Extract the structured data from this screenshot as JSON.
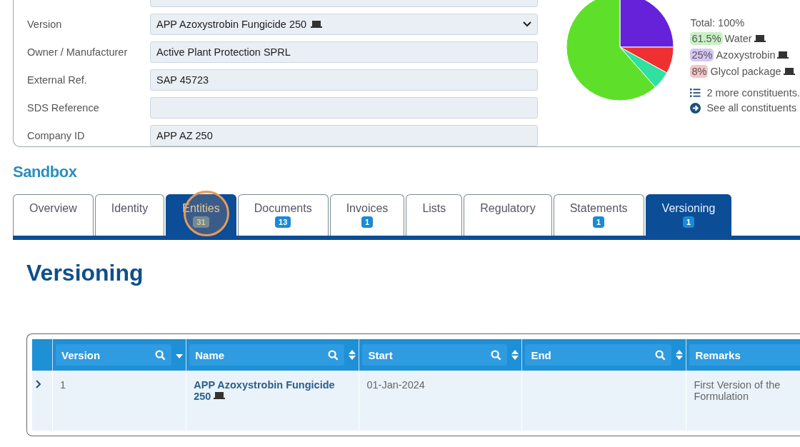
{
  "form": {
    "fields": [
      {
        "label": "Version",
        "value": "APP Azoxystrobin Fungicide 250",
        "kind": "select",
        "device": true
      },
      {
        "label": "Owner / Manufacturer",
        "value": "Active Plant Protection SPRL",
        "kind": "text",
        "device": false
      },
      {
        "label": "External Ref.",
        "value": "SAP 45723",
        "kind": "text",
        "device": false
      },
      {
        "label": "SDS Reference",
        "kind": "text",
        "device": false
      },
      {
        "label": "Company ID",
        "value": "APP AZ 250",
        "kind": "text",
        "device": false
      }
    ]
  },
  "composition": {
    "total": "Total: 100%",
    "constituents": [
      {
        "percent": "61.5%",
        "name": "Water",
        "color": "#c9f0c4"
      },
      {
        "percent": "25%",
        "name": "Azoxystrobin",
        "color": "#d6c6f5"
      },
      {
        "percent": "8%",
        "name": "Glycol package",
        "color": "#f5c6c6"
      }
    ],
    "more": "2 more constituents.",
    "see_all": "See all constituents"
  },
  "section_title": "Sandbox",
  "tabs": [
    {
      "label": "Overview",
      "selected": false,
      "hovered": false
    },
    {
      "label": "Identity",
      "selected": false,
      "hovered": false
    },
    {
      "label": "Entities",
      "count": "31",
      "selected": false,
      "hovered": true
    },
    {
      "label": "Documents",
      "count": "13",
      "selected": false,
      "hovered": false
    },
    {
      "label": "Invoices",
      "count": "1",
      "selected": false,
      "hovered": false
    },
    {
      "label": "Lists",
      "selected": false,
      "hovered": false
    },
    {
      "label": "Regulatory",
      "selected": false,
      "hovered": false
    },
    {
      "label": "Statements",
      "count": "1",
      "selected": false,
      "hovered": false
    },
    {
      "label": "Versioning",
      "count": "1",
      "selected": true,
      "hovered": false
    }
  ],
  "page_title": "Versioning",
  "table": {
    "columns": [
      {
        "label": "Version",
        "kind": "sorted"
      },
      {
        "label": "Name",
        "kind": "sortable"
      },
      {
        "label": "Start",
        "kind": "sortable"
      },
      {
        "label": "End",
        "kind": "sortable"
      },
      {
        "label": "Remarks",
        "kind": "plain"
      }
    ],
    "rows": [
      {
        "expanded": false,
        "version": "1",
        "name": "APP Azoxystrobin Fungicide 250",
        "start": "01-Jan-2024",
        "remarks": "First Version of the Formulation"
      }
    ]
  }
}
